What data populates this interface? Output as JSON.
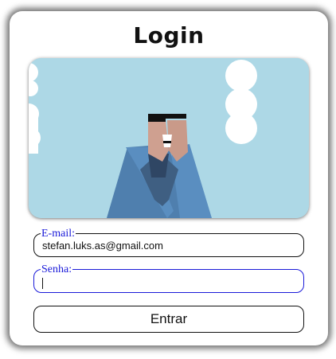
{
  "login": {
    "title": "Login",
    "email": {
      "label": "E-mail:",
      "value": "stefan.luks.as@gmail.com"
    },
    "password": {
      "label": "Senha:",
      "value": ""
    },
    "submit_label": "Entrar"
  },
  "colors": {
    "sky": "#add8e6",
    "legend_text": "#1a1ad9",
    "jacket": "#4f7fae",
    "skin": "#cfa090"
  },
  "icons": {
    "illustration": "person-praying-illustration"
  }
}
